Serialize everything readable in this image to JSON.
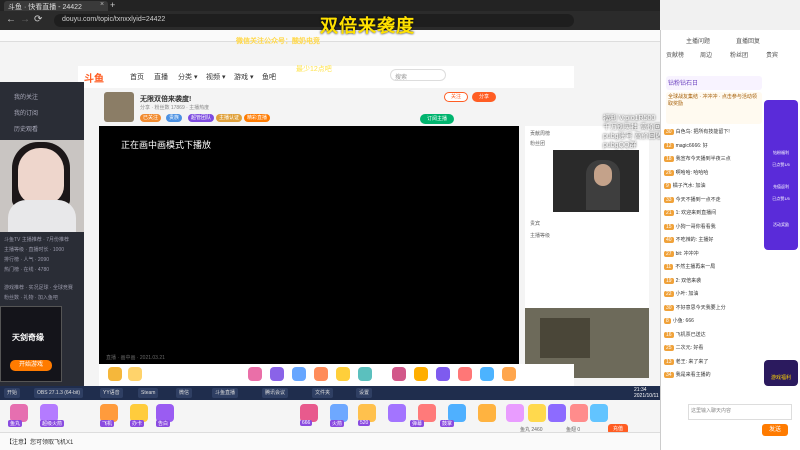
{
  "browser": {
    "tab_title": "斗鱼 · 快看直播 - 24422",
    "url": "douyu.com/topic/txnxxlyid=24422",
    "back": "←",
    "forward": "→",
    "reload": "⟳",
    "close_tab": "×",
    "new_tab": "+"
  },
  "overlay": {
    "title": "双倍来袭度",
    "wechat": "微信关注公众号：酸奶电竞",
    "min_hint": "最少12点吧"
  },
  "header": {
    "logo": "斗鱼",
    "nav": [
      "首页",
      "直播",
      "分类 ▾",
      "视频 ▾",
      "游戏 ▾",
      "鱼吧"
    ],
    "search_placeholder": "搜索"
  },
  "room": {
    "title": "无限双倍来袭度!",
    "meta": "分享 · 粉丝数 17869 · 主播热度",
    "badges": [
      "已关注",
      "贵族",
      "超管团队",
      "主播认证",
      "精彩直播"
    ],
    "follow": "关注",
    "share": "分享",
    "green_pill": "订阅主播"
  },
  "video": {
    "pip_message": "正在画中画模式下播放",
    "caption": "直播 · 画中画 · 2021.03.21"
  },
  "sidebar": {
    "items": [
      "我的关注",
      "我的订阅",
      "历史观看"
    ],
    "table_rows": [
      "斗鱼TV 主播推荐 · 7月份推荐",
      "主播等级 · 直播时长 · 1000",
      "排行榜 · 人气 · 2090",
      "热门榜 · 在线 · 4780",
      "游戏推荐 · 实况足球 · 全球竞赛",
      "粉丝数 · 礼物 · 加入鱼吧"
    ],
    "avatar_name": "天剑奇缘",
    "avatar_button": "开始游戏"
  },
  "cam_text": "福利 V:pio1R500\n千万别买挂 高价回收\npubg账号 高价回收 QQ群\npubgQQ群",
  "chat_ranks": [
    "贡献周榜",
    "粉丝团",
    "贵宾",
    "主播等级"
  ],
  "taskbar": {
    "items": [
      "开始",
      "OBS 27.1.3 (64-bit)",
      "YY语音",
      "Steam",
      "微信",
      "斗鱼直播",
      "腾讯会议",
      "文件夹",
      "设置"
    ],
    "clock_time": "21:34",
    "clock_date": "2021/10/11"
  },
  "gift_labels": [
    "鱼丸",
    "超级火箭",
    "飞机",
    "办卡",
    "告白",
    "666",
    "火箭",
    "520",
    "弹幕",
    "鼓掌"
  ],
  "bottom": {
    "status_text": "【注意】您可领取飞机X1",
    "coins": "鱼丸 2460",
    "yuchi": "鱼翅 0",
    "recharge": "充值",
    "send": "发送",
    "chat_placeholder": "这里输入聊天内容"
  },
  "sidepanel": {
    "tabs": [
      "主播问题",
      "直播回复"
    ],
    "subtabs": [
      "贡献榜",
      "周边",
      "粉丝团",
      "贵宾"
    ],
    "rank_card": "钻粉钻石日",
    "event": "全球战友集结 · 冲冲冲 · 点击参与活动领取奖励",
    "chat_lines": [
      {
        "lvl": "30",
        "text": "白色鸟: 把所有技能留下!"
      },
      {
        "lvl": "12",
        "text": "magic6666: 好"
      },
      {
        "lvl": "18",
        "text": "我宣布今天播到半夜三点"
      },
      {
        "lvl": "26",
        "text": "啊哈哈: 哈哈哈"
      },
      {
        "lvl": "9",
        "text": "橘子汽水: 加油"
      },
      {
        "lvl": "33",
        "text": "今天不播到一点不走"
      },
      {
        "lvl": "21",
        "text": "1: 欢迎来到直播间"
      },
      {
        "lvl": "15",
        "text": "小狗一哥你看看我"
      },
      {
        "lvl": "40",
        "text": "不吃辣的: 主播好"
      },
      {
        "lvl": "27",
        "text": "bit: 冲冲冲"
      },
      {
        "lvl": "11",
        "text": "不然主播再来一局"
      },
      {
        "lvl": "19",
        "text": "2: 双倍来袭"
      },
      {
        "lvl": "22",
        "text": "小叶: 加油"
      },
      {
        "lvl": "30",
        "text": "不好意思今天我要上分"
      },
      {
        "lvl": "8",
        "text": "小鱼: 666"
      },
      {
        "lvl": "16",
        "text": "飞机票已送达"
      },
      {
        "lvl": "25",
        "text": "二次元: 好看"
      },
      {
        "lvl": "13",
        "text": "老王: 来了来了"
      },
      {
        "lvl": "34",
        "text": "我是来看主播的"
      }
    ],
    "promo_items": [
      "钻粉福利",
      "已点赞1/5",
      "充值返利",
      "已点赞1/5",
      "活动奖励"
    ],
    "promo_badge": "游戏福利"
  }
}
